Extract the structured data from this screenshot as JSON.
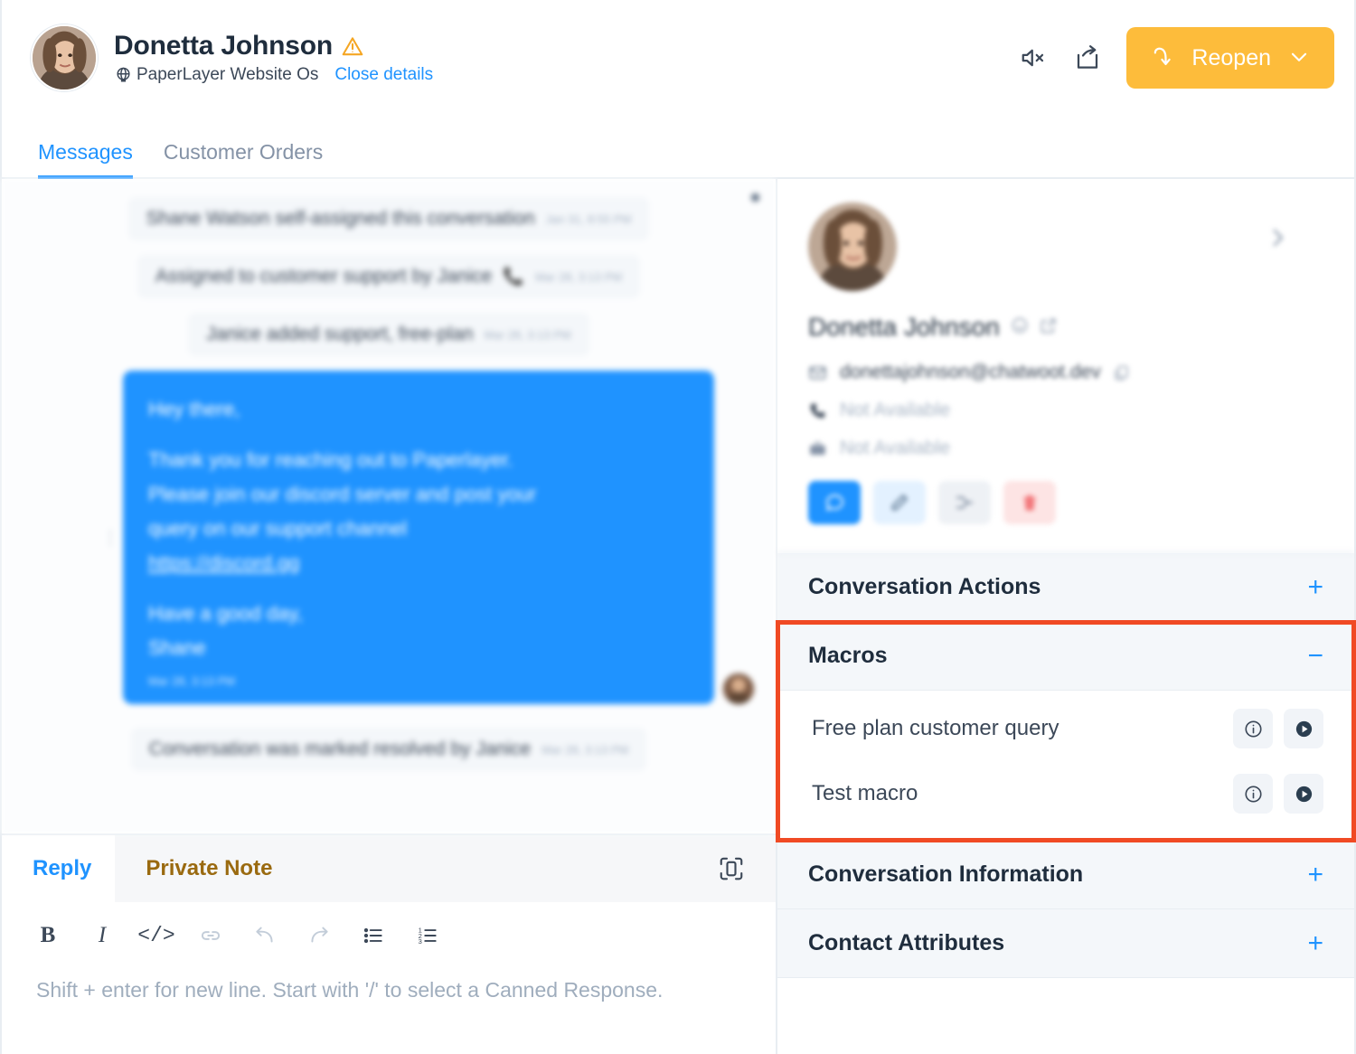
{
  "header": {
    "contact_name": "Donetta Johnson",
    "warning_icon": "warning-triangle-icon",
    "globe_icon": "globe-icon",
    "inbox_name": "PaperLayer Website Os",
    "close_details_label": "Close details",
    "mute_icon": "mute-speaker-icon",
    "share_icon": "share-external-icon",
    "reopen_label": "Reopen",
    "reopen_icon": "reopen-arrow-icon",
    "reopen_chevron_icon": "chevron-down-icon",
    "reopen_color": "#FDBC3B"
  },
  "tabs": [
    {
      "label": "Messages",
      "active": true
    },
    {
      "label": "Customer Orders",
      "active": false
    }
  ],
  "conversation": {
    "activities": [
      {
        "text": "Shane Watson self-assigned this conversation",
        "time": "Jan 31, 8:55 PM",
        "align": "center"
      },
      {
        "text": "Assigned to customer support by Janice",
        "time": "Mar 28, 3:13 PM",
        "align": "left",
        "icon": "phone-icon"
      },
      {
        "text": "Janice added support, free-plan",
        "time": "Mar 28, 3:13 PM",
        "align": "center"
      }
    ],
    "message": {
      "greeting": "Hey there,",
      "body_line_1": "Thank you for reaching out to Paperlayer.",
      "body_line_2": "Please join our discord server and post your",
      "body_line_3": "query on our support channel",
      "link_text": "https://discord.gg",
      "closing_1": "Have a good day,",
      "closing_2": "Shane",
      "time": "Mar 28, 3:13 PM",
      "bubble_color": "#1f93ff"
    },
    "resolved_activity": {
      "text": "Conversation was marked resolved by Janice",
      "time": "Mar 28, 3:13 PM"
    }
  },
  "reply_box": {
    "tab_reply": "Reply",
    "tab_note": "Private Note",
    "expand_icon": "expand-editor-icon",
    "toolbar": [
      {
        "name": "bold-icon",
        "glyph": "B",
        "dim": false
      },
      {
        "name": "italic-icon",
        "glyph": "I",
        "dim": false
      },
      {
        "name": "code-icon",
        "glyph": "</>",
        "dim": false
      },
      {
        "name": "link-icon",
        "glyph": "link",
        "dim": true
      },
      {
        "name": "undo-icon",
        "glyph": "undo",
        "dim": true
      },
      {
        "name": "redo-icon",
        "glyph": "redo",
        "dim": true
      },
      {
        "name": "bullet-list-icon",
        "glyph": "ul",
        "dim": false
      },
      {
        "name": "ordered-list-icon",
        "glyph": "ol",
        "dim": false
      }
    ],
    "placeholder": "Shift + enter for new line. Start with '/' to select a Canned Response."
  },
  "sidebar": {
    "contact": {
      "name": "Donetta Johnson",
      "email": "donettajohnson@chatwoot.dev",
      "phone": "Not Available",
      "company": "Not Available",
      "expand_chevron_icon": "chevron-right-icon",
      "name_icons": [
        "smiley-icon",
        "external-link-icon"
      ],
      "email_icon": "mail-icon",
      "copy_icon": "copy-icon",
      "phone_icon": "phone-icon",
      "company_icon": "briefcase-icon",
      "actions": [
        {
          "name": "new-conversation-button",
          "icon": "chat-icon",
          "style": "primary"
        },
        {
          "name": "edit-contact-button",
          "icon": "pencil-icon",
          "style": "edit"
        },
        {
          "name": "merge-contact-button",
          "icon": "merge-icon",
          "style": "merge"
        },
        {
          "name": "delete-contact-button",
          "icon": "trash-icon",
          "style": "del"
        }
      ]
    },
    "sections": [
      {
        "title": "Conversation Actions",
        "sign": "+",
        "expanded": false
      },
      {
        "title": "Macros",
        "sign": "−",
        "expanded": true
      },
      {
        "title": "Conversation Information",
        "sign": "+",
        "expanded": false
      },
      {
        "title": "Contact Attributes",
        "sign": "+",
        "expanded": false
      }
    ],
    "macros": [
      {
        "name": "Free plan customer query",
        "info_icon": "info-circle-icon",
        "run_icon": "play-circle-icon"
      },
      {
        "name": "Test macro",
        "info_icon": "info-circle-icon",
        "run_icon": "play-circle-icon"
      }
    ],
    "highlight_color": "#F04A24"
  }
}
